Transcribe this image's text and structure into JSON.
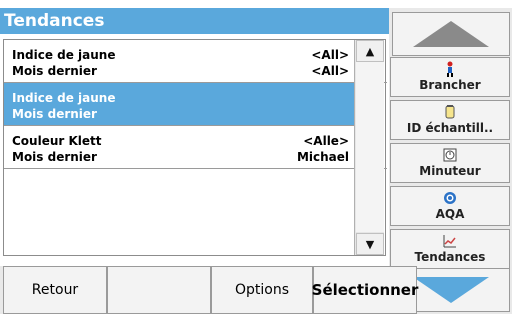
{
  "title": "Tendances",
  "list": {
    "rows": [
      {
        "left1": "Indice de jaune",
        "left2": "Mois dernier",
        "right1": "<All>",
        "right2": "<All>",
        "selected": false
      },
      {
        "left1": "Indice de jaune",
        "left2": "Mois dernier",
        "right1": "",
        "right2": "",
        "selected": true
      },
      {
        "left1": "Couleur Klett",
        "left2": "Mois dernier",
        "right1": "<Alle>",
        "right2": "Michael",
        "selected": false
      }
    ]
  },
  "side_buttons": [
    {
      "label": "Brancher",
      "icon": "person-icon"
    },
    {
      "label": "ID échantill..",
      "icon": "sample-id-icon"
    },
    {
      "label": "Minuteur",
      "icon": "timer-icon"
    },
    {
      "label": "AQA",
      "icon": "aqa-icon"
    },
    {
      "label": "Tendances",
      "icon": "trends-icon"
    }
  ],
  "bottom": {
    "back": "Retour",
    "options": "Options",
    "select": "Sélectionner"
  },
  "colors": {
    "accent": "#5aa8dc",
    "scroll_arrow_up": "#8a8a8a",
    "scroll_arrow_down": "#5aa8dc"
  }
}
